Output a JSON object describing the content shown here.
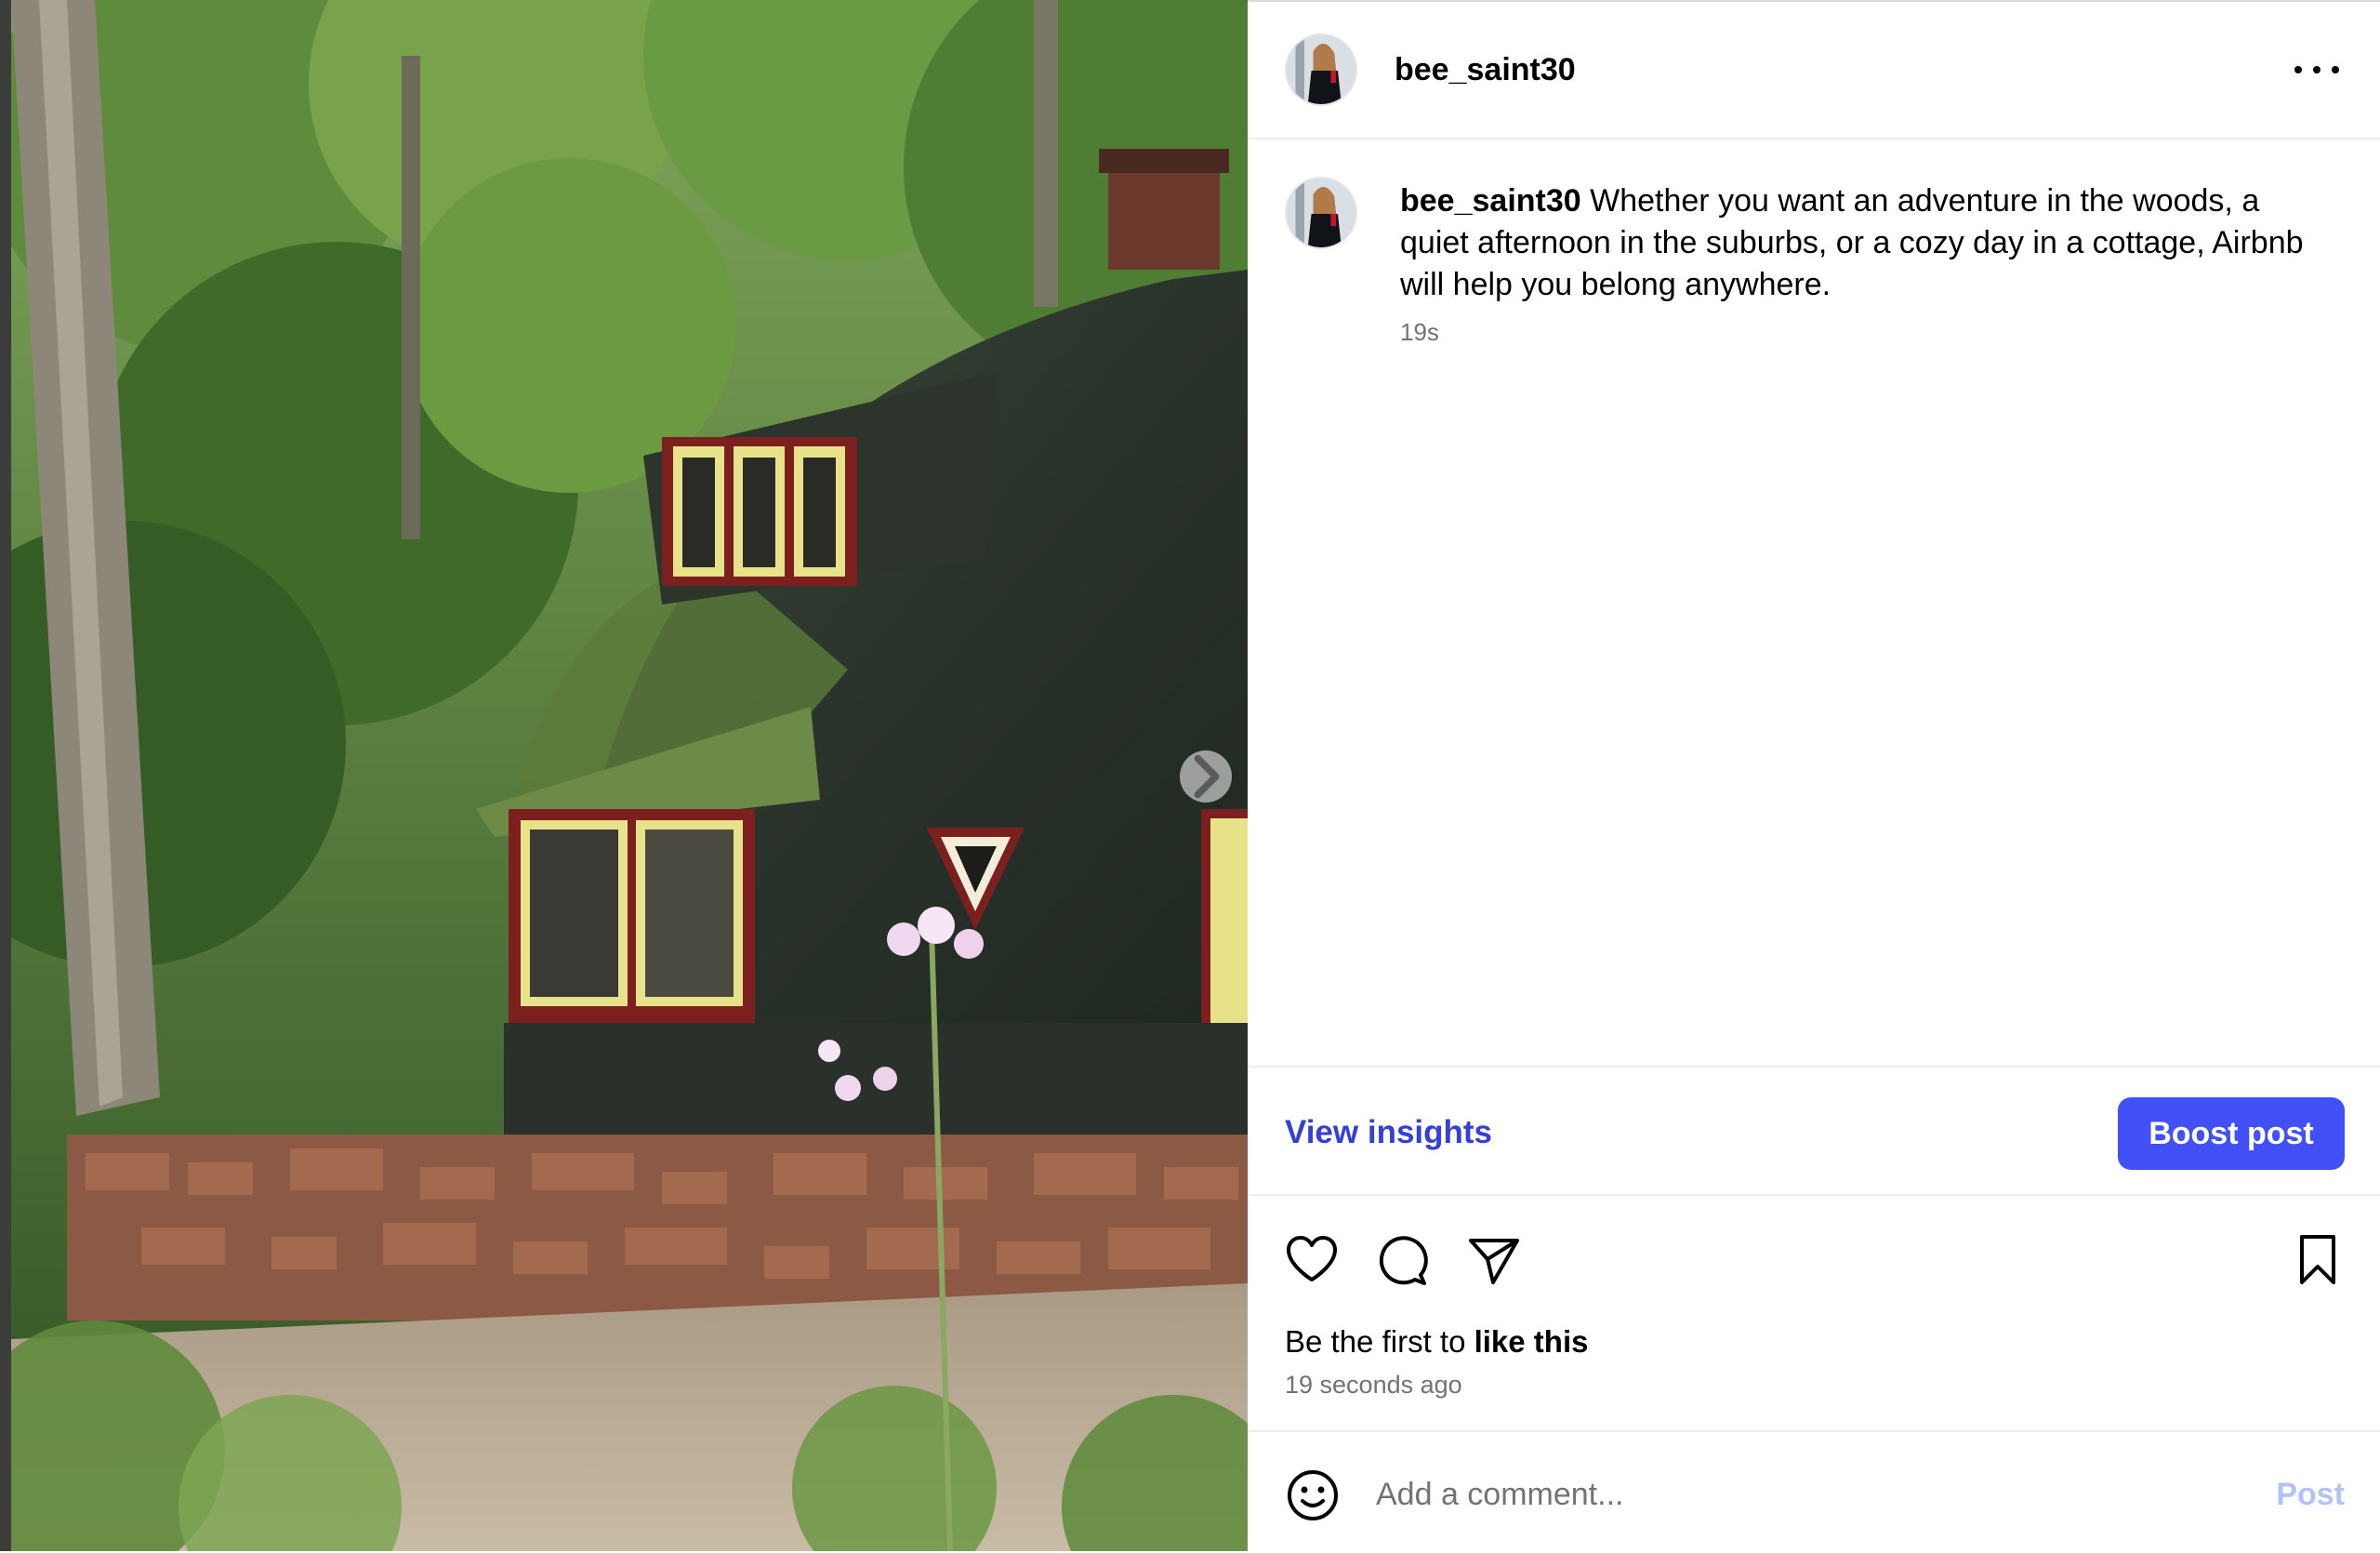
{
  "post": {
    "username": "bee_saint30",
    "caption_username": "bee_saint30",
    "caption": "Whether you want an adventure in the woods, a quiet afternoon in the suburbs, or a cozy day in a cottage, Airbnb will help you belong anywhere.",
    "caption_time": "19s",
    "likes_prefix": "Be the first to ",
    "likes_action": "like this",
    "time_ago": "19 seconds ago"
  },
  "actions": {
    "view_insights": "View insights",
    "boost_post": "Boost post"
  },
  "comment": {
    "placeholder": "Add a comment...",
    "post_label": "Post"
  },
  "icons": {
    "more": "more-options-icon",
    "like": "heart-icon",
    "comment": "comment-bubble-icon",
    "share": "paper-plane-icon",
    "save": "bookmark-icon",
    "emoji": "smiley-icon",
    "next": "chevron-right-icon"
  },
  "colors": {
    "accent": "#4150f7",
    "link": "#3540d8",
    "muted": "#737373",
    "post_disabled": "#b2c3fb"
  }
}
